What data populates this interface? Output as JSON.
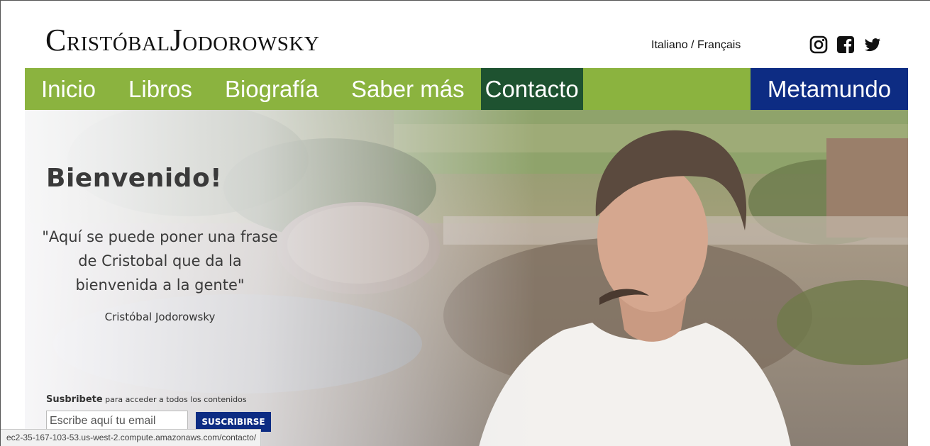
{
  "header": {
    "logo_first_initial": "C",
    "logo_first_rest": "RISTÓBAL",
    "logo_second_initial": "J",
    "logo_second_rest": "ODOROWSKY",
    "lang_italiano": "Italiano",
    "lang_separator": " / ",
    "lang_francais": "Français",
    "social_icons": [
      "instagram-icon",
      "facebook-icon",
      "twitter-icon"
    ]
  },
  "nav": {
    "items": [
      {
        "label": "Inicio"
      },
      {
        "label": "Libros"
      },
      {
        "label": "Biografía"
      },
      {
        "label": "Saber más"
      },
      {
        "label": "Contacto"
      }
    ],
    "metamundo": "Metamundo",
    "colors": {
      "bar": "#8bb33f",
      "active": "#1e5230",
      "metamundo": "#0d2c83"
    }
  },
  "hero": {
    "title": "Bienvenido!",
    "quote": "\"Aquí se puede poner una frase de Cristobal que da la bienvenida a la gente\"",
    "author": "Cristóbal Jodorowsky"
  },
  "subscribe": {
    "label_bold": "Susbribete",
    "label_rest": " para acceder a todos los contenidos",
    "email_placeholder": "Escribe aquí tu email",
    "button": "SUSCRIBIRSE"
  },
  "status_url": "ec2-35-167-103-53.us-west-2.compute.amazonaws.com/contacto/"
}
